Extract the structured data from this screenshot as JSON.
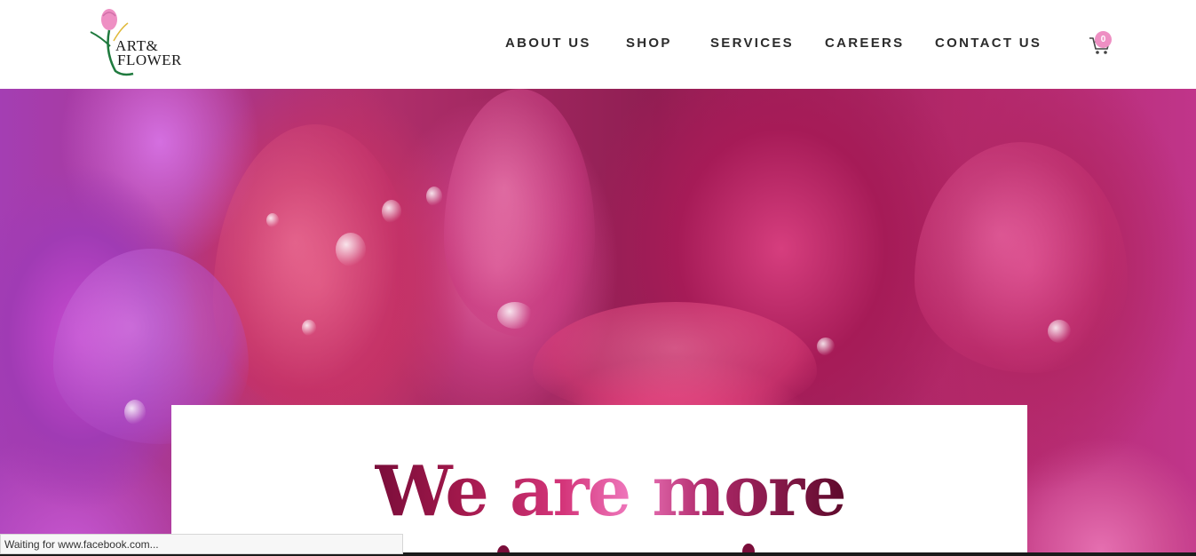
{
  "brand": {
    "logo_line1": "ART&",
    "logo_line2": "FLOWER",
    "accent": "#ee8fc3"
  },
  "nav": {
    "items": [
      {
        "label": "ABOUT US"
      },
      {
        "label": "SHOP"
      },
      {
        "label": "SERVICES"
      },
      {
        "label": "CAREERS"
      },
      {
        "label": "CONTACT US"
      }
    ],
    "cart_icon": "cart-icon",
    "cart_count": "0"
  },
  "hero": {
    "headline": "We are more",
    "image": "pink-flower-petals-photo"
  },
  "browser": {
    "status_text": "Waiting for www.facebook.com..."
  }
}
